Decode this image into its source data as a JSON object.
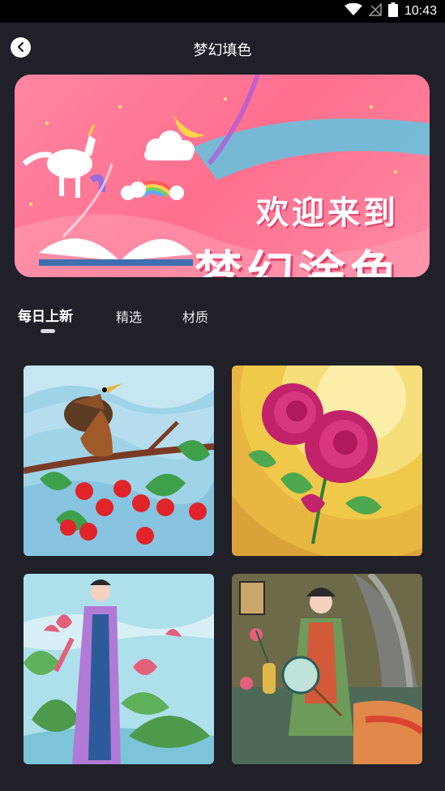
{
  "status_bar": {
    "time": "10:43"
  },
  "nav": {
    "title": "梦幻填色"
  },
  "banner": {
    "line1": "欢迎来到",
    "line2": "梦幻涂色"
  },
  "tabs": [
    {
      "label": "每日上新",
      "active": true
    },
    {
      "label": "精选",
      "active": false
    },
    {
      "label": "材质",
      "active": false
    }
  ],
  "cards": [
    {
      "subject": "bird-cherries"
    },
    {
      "subject": "rose"
    },
    {
      "subject": "lady-lotus"
    },
    {
      "subject": "lady-fan"
    }
  ]
}
